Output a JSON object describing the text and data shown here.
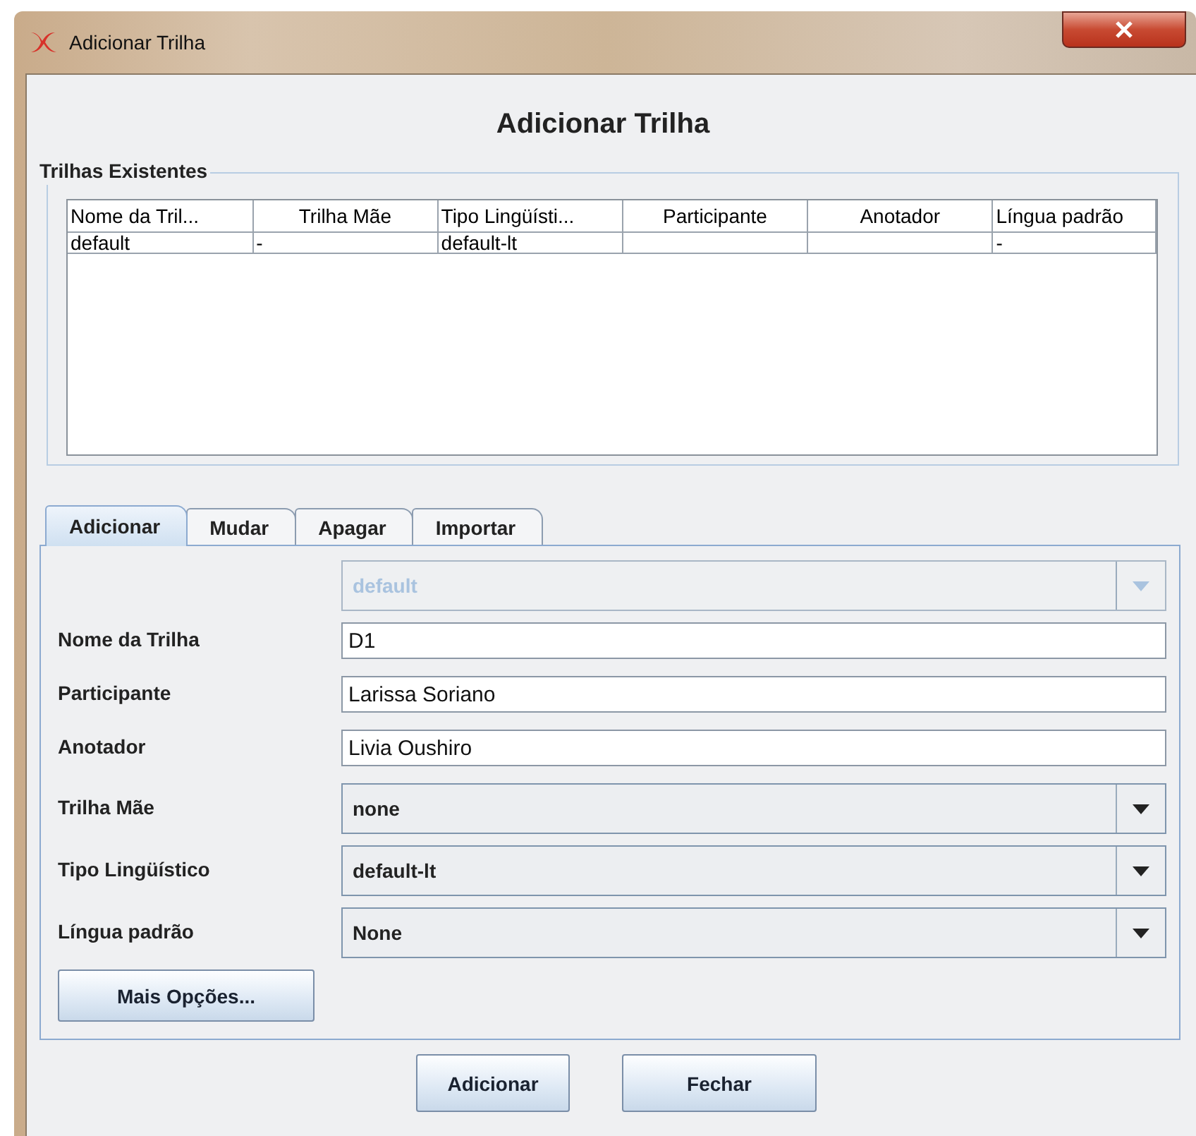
{
  "window": {
    "title": "Adicionar Trilha"
  },
  "heading": "Adicionar Trilha",
  "existing_tiers": {
    "title": "Trilhas Existentes",
    "columns": [
      "Nome da Tril...",
      "Trilha Mãe",
      "Tipo Lingüísti...",
      "Participante",
      "Anotador",
      "Língua padrão"
    ],
    "rows": [
      {
        "cells": [
          "default",
          "-",
          "default-lt",
          null,
          null,
          "-"
        ]
      }
    ]
  },
  "tabs": [
    {
      "label": "Adicionar",
      "selected": true
    },
    {
      "label": "Mudar",
      "selected": false
    },
    {
      "label": "Apagar",
      "selected": false
    },
    {
      "label": "Importar",
      "selected": false
    }
  ],
  "form": {
    "fields": [
      {
        "kind": "select",
        "value": "default",
        "disabled": true
      },
      {
        "kind": "text",
        "label": "Nome da Trilha",
        "value": "D1"
      },
      {
        "kind": "text",
        "label": "Participante",
        "value": "Larissa Soriano"
      },
      {
        "kind": "text",
        "label": "Anotador",
        "value": "Livia Oushiro"
      },
      {
        "kind": "select",
        "label": "Trilha Mãe",
        "value": "none",
        "disabled": false
      },
      {
        "kind": "select",
        "label": "Tipo Lingüístico",
        "value": "default-lt",
        "disabled": false
      },
      {
        "kind": "select",
        "label": "Língua padrão",
        "value": "None",
        "disabled": false
      }
    ],
    "more_options_button": "Mais Opções..."
  },
  "buttons": [
    "Adicionar",
    "Fechar"
  ]
}
